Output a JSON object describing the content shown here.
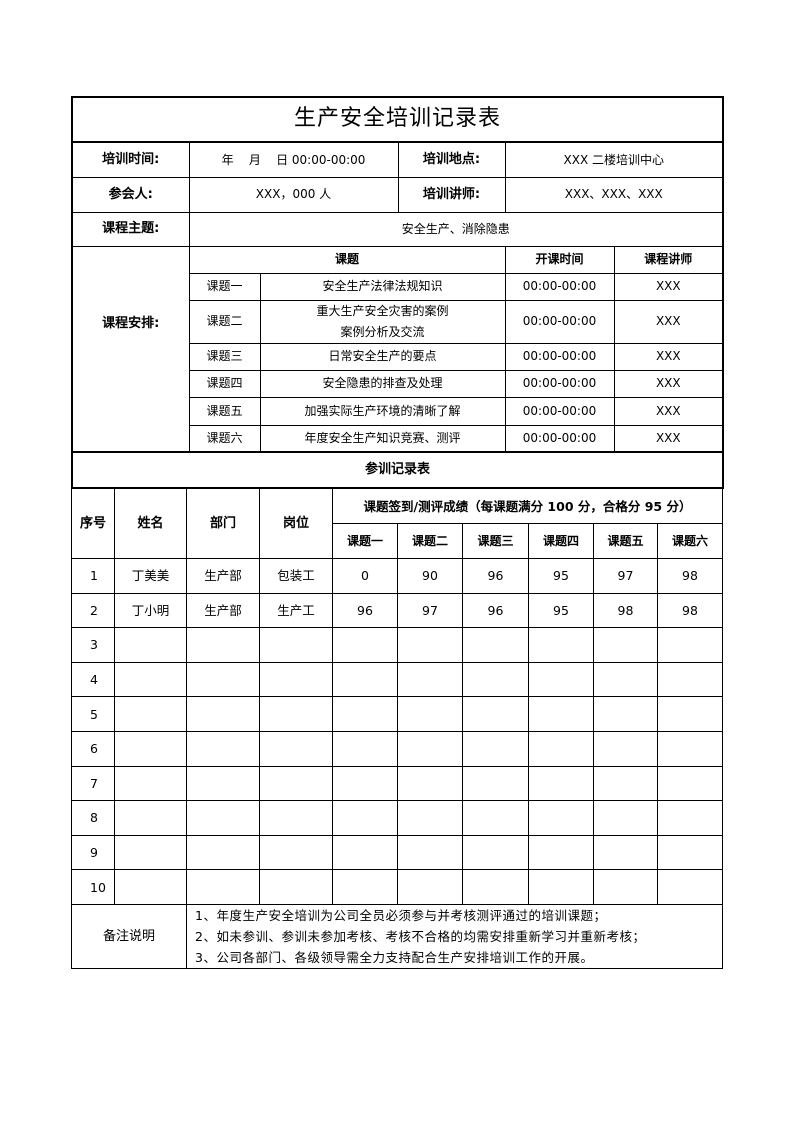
{
  "title": "生产安全培训记录表",
  "info": {
    "training_time_label": "培训时间:",
    "training_time_value": "年    月    日 00:00-00:00",
    "location_label": "培训地点:",
    "location_value": "XXX 二楼培训中心",
    "attendees_label": "参会人:",
    "attendees_value": "XXX，000 人",
    "instructor_label": "培训讲师:",
    "instructor_value": "XXX、XXX、XXX",
    "theme_label": "课程主题:",
    "theme_value": "安全生产、消除隐患"
  },
  "schedule": {
    "label": "课程安排:",
    "headers": {
      "topic": "课题",
      "time": "开课时间",
      "teacher": "课程讲师"
    },
    "rows": [
      {
        "no": "课题一",
        "topic": "安全生产法律法规知识",
        "topic2": "",
        "time": "00:00-00:00",
        "teacher": "XXX"
      },
      {
        "no": "课题二",
        "topic": "重大生产安全灾害的案例",
        "topic2": "案例分析及交流",
        "time": "00:00-00:00",
        "teacher": "XXX"
      },
      {
        "no": "课题三",
        "topic": "日常安全生产的要点",
        "topic2": "",
        "time": "00:00-00:00",
        "teacher": "XXX"
      },
      {
        "no": "课题四",
        "topic": "安全隐患的排查及处理",
        "topic2": "",
        "time": "00:00-00:00",
        "teacher": "XXX"
      },
      {
        "no": "课题五",
        "topic": "加强实际生产环境的清晰了解",
        "topic2": "",
        "time": "00:00-00:00",
        "teacher": "XXX"
      },
      {
        "no": "课题六",
        "topic": "年度安全生产知识竞赛、测评",
        "topic2": "",
        "time": "00:00-00:00",
        "teacher": "XXX"
      }
    ]
  },
  "attendance": {
    "section_title": "参训记录表",
    "headers": {
      "seq": "序号",
      "name": "姓名",
      "dept": "部门",
      "post": "岗位",
      "scores_group": "课题签到/测评成绩（每课题满分 100 分，合格分 95 分）",
      "topics": [
        "课题一",
        "课题二",
        "课题三",
        "课题四",
        "课题五",
        "课题六"
      ]
    },
    "rows": [
      {
        "seq": "1",
        "name": "丁美美",
        "dept": "生产部",
        "post": "包装工",
        "scores": [
          "0",
          "90",
          "96",
          "95",
          "97",
          "98"
        ]
      },
      {
        "seq": "2",
        "name": "丁小明",
        "dept": "生产部",
        "post": "生产工",
        "scores": [
          "96",
          "97",
          "96",
          "95",
          "98",
          "98"
        ]
      },
      {
        "seq": "3",
        "name": "",
        "dept": "",
        "post": "",
        "scores": [
          "",
          "",
          "",
          "",
          "",
          ""
        ]
      },
      {
        "seq": "4",
        "name": "",
        "dept": "",
        "post": "",
        "scores": [
          "",
          "",
          "",
          "",
          "",
          ""
        ]
      },
      {
        "seq": "5",
        "name": "",
        "dept": "",
        "post": "",
        "scores": [
          "",
          "",
          "",
          "",
          "",
          ""
        ]
      },
      {
        "seq": "6",
        "name": "",
        "dept": "",
        "post": "",
        "scores": [
          "",
          "",
          "",
          "",
          "",
          ""
        ]
      },
      {
        "seq": "7",
        "name": "",
        "dept": "",
        "post": "",
        "scores": [
          "",
          "",
          "",
          "",
          "",
          ""
        ]
      },
      {
        "seq": "8",
        "name": "",
        "dept": "",
        "post": "",
        "scores": [
          "",
          "",
          "",
          "",
          "",
          ""
        ]
      },
      {
        "seq": "9",
        "name": "",
        "dept": "",
        "post": "",
        "scores": [
          "",
          "",
          "",
          "",
          "",
          ""
        ]
      },
      {
        "seq": "10",
        "name": "",
        "dept": "",
        "post": "",
        "scores": [
          "",
          "",
          "",
          "",
          "",
          ""
        ]
      }
    ]
  },
  "notes": {
    "label": "备注说明",
    "lines": [
      "1、年度生产安全培训为公司全员必须参与并考核测评通过的培训课题；",
      "2、如未参训、参训未参加考核、考核不合格的均需安排重新学习并重新考核；",
      "3、公司各部门、各级领导需全力支持配合生产安排培训工作的开展。"
    ]
  }
}
